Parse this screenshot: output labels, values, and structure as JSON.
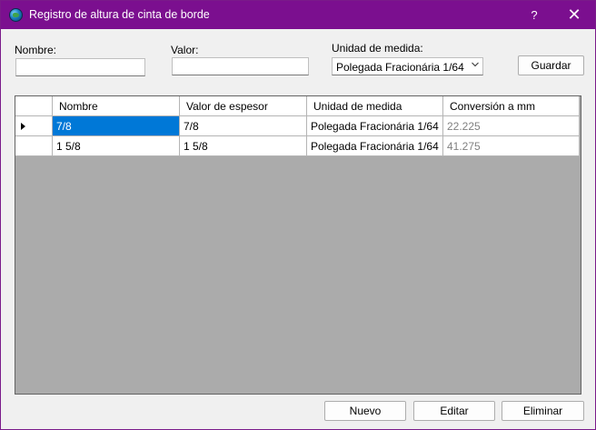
{
  "window": {
    "title": "Registro de altura de cinta de borde",
    "help_glyph": "?",
    "close_glyph": "✕",
    "icon": "globe-icon"
  },
  "form": {
    "nombre_label": "Nombre:",
    "nombre_value": "",
    "valor_label": "Valor:",
    "valor_value": "",
    "unidad_label": "Unidad de medida:",
    "unidad_selected": "Polegada Fracionária 1/64",
    "guardar_label": "Guardar"
  },
  "grid": {
    "columns": [
      "Nombre",
      "Valor de espesor",
      "Unidad de medida",
      "Conversión a mm"
    ],
    "rows": [
      [
        "7/8",
        "7/8",
        "Polegada Fracionária 1/64",
        "22.225"
      ],
      [
        "1 5/8",
        "1 5/8",
        "Polegada Fracionária 1/64",
        "41.275"
      ]
    ],
    "current_row_indicator": "arrow-right-icon"
  },
  "actions": {
    "nuevo_label": "Nuevo",
    "editar_label": "Editar",
    "eliminar_label": "Eliminar"
  }
}
